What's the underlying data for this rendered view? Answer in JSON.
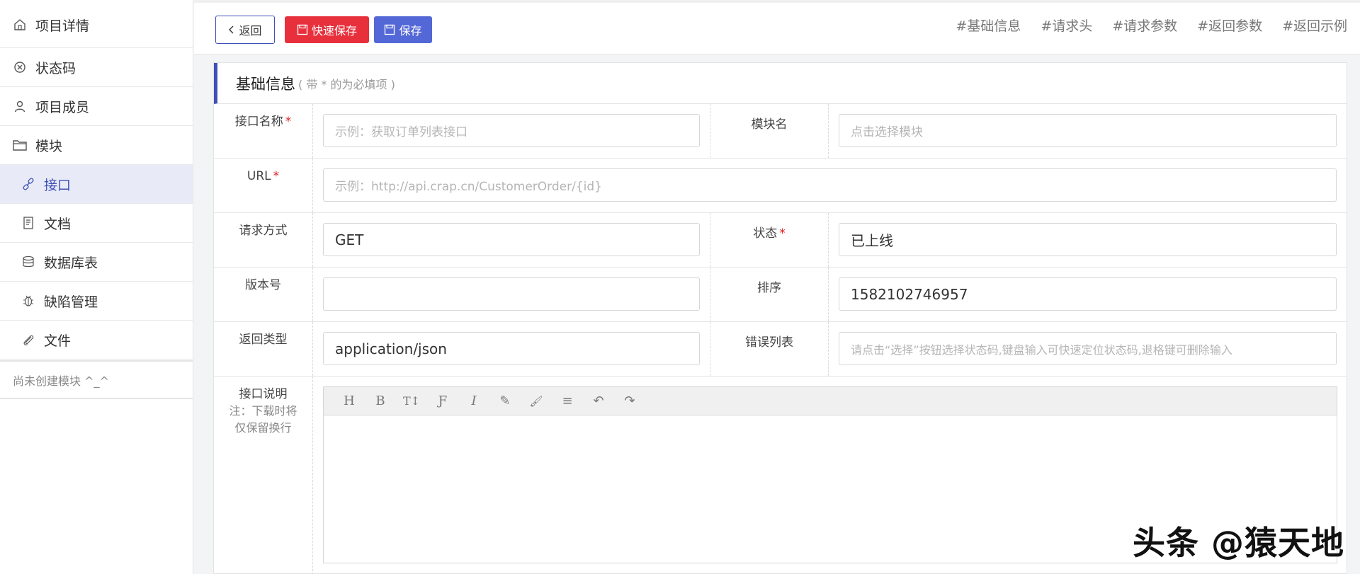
{
  "sidebar": {
    "items": [
      {
        "label": "项目详情",
        "icon": "home-icon"
      },
      {
        "label": "状态码",
        "icon": "circle-x-icon"
      },
      {
        "label": "项目成员",
        "icon": "user-icon"
      },
      {
        "label": "模块",
        "icon": "folder-icon"
      },
      {
        "label": "接口",
        "icon": "link-icon"
      },
      {
        "label": "文档",
        "icon": "document-icon"
      },
      {
        "label": "数据库表",
        "icon": "database-icon"
      },
      {
        "label": "缺陷管理",
        "icon": "bug-icon"
      },
      {
        "label": "文件",
        "icon": "paperclip-icon"
      }
    ],
    "empty_text": "尚未创建模块 ^_^"
  },
  "toolbar": {
    "back_label": "返回",
    "quick_save_label": "快速保存",
    "save_label": "保存",
    "anchors": [
      "#基础信息",
      "#请求头",
      "#请求参数",
      "#返回参数",
      "#返回示例"
    ]
  },
  "card": {
    "title": "基础信息",
    "hint": "( 带 * 的为必填项 )"
  },
  "form": {
    "name_label": "接口名称",
    "name_placeholder": "示例：获取订单列表接口",
    "module_label": "模块名",
    "module_placeholder": "点击选择模块",
    "url_label": "URL",
    "url_placeholder": "示例：http://api.crap.cn/CustomerOrder/{id}",
    "method_label": "请求方式",
    "method_value": "GET",
    "status_label": "状态",
    "status_value": "已上线",
    "version_label": "版本号",
    "version_value": "",
    "sort_label": "排序",
    "sort_value": "1582102746957",
    "return_type_label": "返回类型",
    "return_type_value": "application/json",
    "error_list_label": "错误列表",
    "error_list_placeholder": "请点击“选择”按钮选择状态码,键盘输入可快速定位状态码,退格键可删除输入",
    "desc_label": "接口说明",
    "desc_note_1": "注：下载时将",
    "desc_note_2": "仅保留换行",
    "required_mark": "*"
  },
  "editor": {
    "tools": [
      "H",
      "B",
      "T↕",
      "Ƒ",
      "I",
      "✎",
      "🖌",
      "≡",
      "↶",
      "↷"
    ]
  },
  "watermark": "头条 @猿天地",
  "colors": {
    "accent": "#3f51b5",
    "danger": "#e8303d",
    "save": "#5467d6"
  }
}
